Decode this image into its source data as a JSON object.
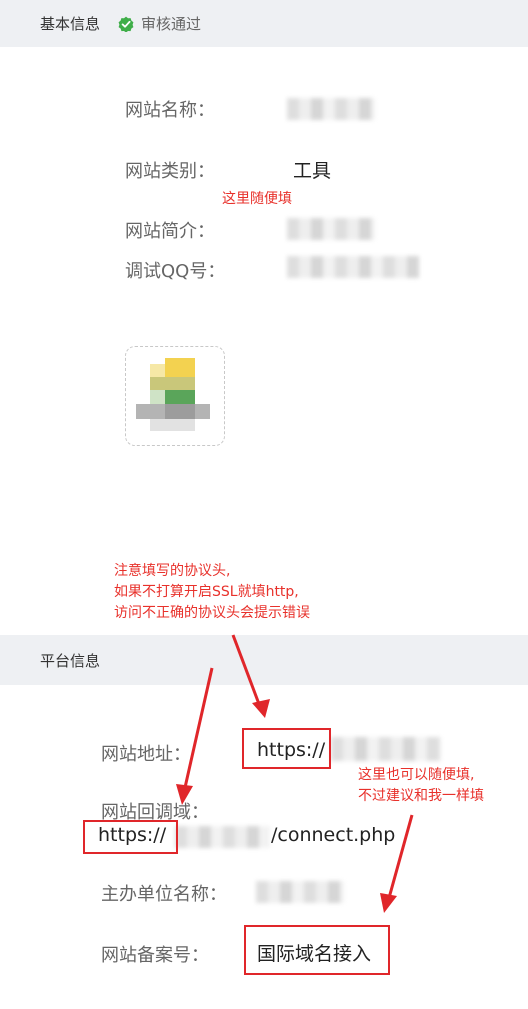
{
  "basic_info": {
    "section_title": "基本信息",
    "status_text": "审核通过",
    "site_name_label": "网站名称：",
    "site_category_label": "网站类别：",
    "site_category_value": "工具",
    "site_intro_label": "网站简介：",
    "debug_qq_label": "调试QQ号："
  },
  "platform_info": {
    "section_title": "平台信息",
    "site_url_label": "网站地址：",
    "site_url_value_prefix": "https://",
    "callback_label": "网站回调域：",
    "callback_prefix": "https://",
    "callback_suffix": "/connect.php",
    "org_name_label": "主办单位名称：",
    "icp_label": "网站备案号：",
    "icp_value": "国际域名接入"
  },
  "annotations": {
    "casual_fill": "这里随便填",
    "protocol_note": [
      "注意填写的协议头,",
      "如果不打算开启SSL就填http,",
      "访问不正确的协议头会提示错误"
    ],
    "suggest_note": [
      "这里也可以随便填,",
      "不过建议和我一样填"
    ]
  },
  "colors": {
    "annotation_red": "#e8312b",
    "status_green": "#3fae49",
    "header_bg": "#eef0f3"
  }
}
